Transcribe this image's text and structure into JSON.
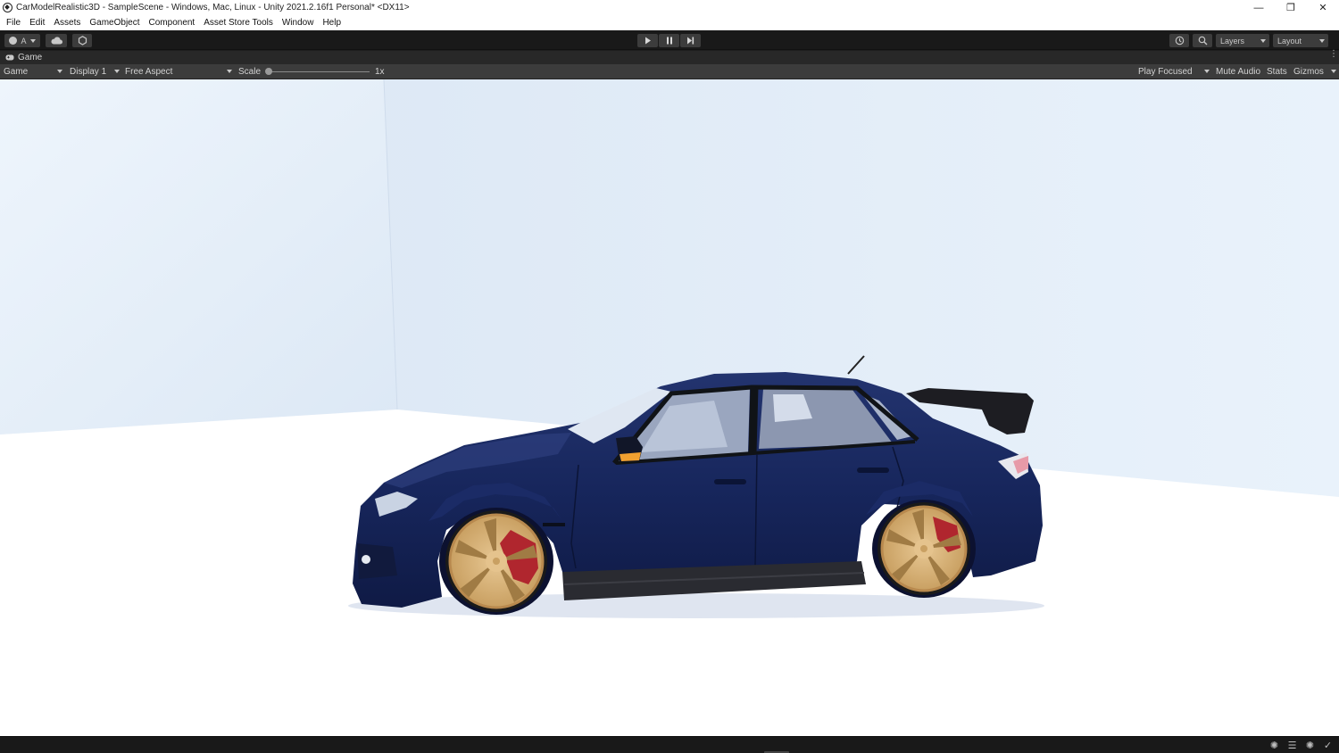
{
  "window": {
    "title": "CarModelRealistic3D - SampleScene - Windows, Mac, Linux - Unity 2021.2.16f1 Personal* <DX11>",
    "controls": [
      "minimize",
      "restore",
      "close"
    ]
  },
  "menu": [
    "File",
    "Edit",
    "Assets",
    "GameObject",
    "Component",
    "Asset Store Tools",
    "Window",
    "Help"
  ],
  "toolbar": {
    "account_label": "A",
    "layers_label": "Layers",
    "layout_label": "Layout"
  },
  "tab": {
    "label": "Game"
  },
  "gameview": {
    "mode": "Game",
    "display": "Display 1",
    "aspect": "Free Aspect",
    "scale_label": "Scale",
    "scale_value": "1x",
    "scale_fraction": 0.0,
    "play_mode": "Play Focused",
    "mute_audio": "Mute Audio",
    "stats": "Stats",
    "gizmos": "Gizmos"
  },
  "scene": {
    "subject": "car",
    "body_color": "#16245e",
    "wheel_color": "#d9b47c",
    "sky_color": "#e4eef8",
    "floor_color": "#ffffff"
  },
  "colors": {
    "editor_dark": "#191919",
    "panel": "#3c3c3c",
    "text": "#d2d2d2"
  }
}
